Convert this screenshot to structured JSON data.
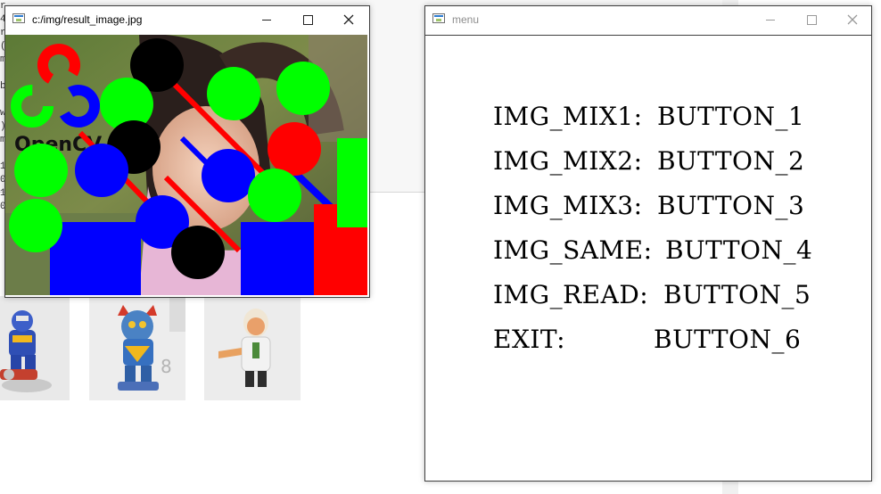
{
  "background_editor": {
    "gutter_lines": [
      "r",
      "4",
      "r",
      "(",
      "m",
      "",
      "b",
      "",
      "w",
      ")",
      "m",
      "",
      "1",
      "0",
      "1",
      "0"
    ]
  },
  "result_window": {
    "title": "c:/img/result_image.jpg",
    "logo_text": "OpenCV",
    "controls": {
      "minimize": "minimize-icon",
      "maximize": "maximize-icon",
      "close": "close-icon"
    }
  },
  "menu_window": {
    "title": "menu",
    "controls": {
      "minimize": "minimize-icon",
      "maximize": "maximize-icon",
      "close": "close-icon"
    },
    "lines": [
      {
        "key": "IMG_MIX1:",
        "value": "BUTTON_1"
      },
      {
        "key": "IMG_MIX2:",
        "value": "BUTTON_2"
      },
      {
        "key": "IMG_MIX3:",
        "value": "BUTTON_3"
      },
      {
        "key": "IMG_SAME:",
        "value": "BUTTON_4"
      },
      {
        "key": "IMG_READ:",
        "value": "BUTTON_5"
      },
      {
        "key": "EXIT:",
        "value": "BUTTON_6"
      }
    ]
  },
  "thumbnails": [
    "robot-toy-thumbnail",
    "cat-robot-toy-thumbnail",
    "scientist-figure-thumbnail"
  ],
  "colors": {
    "red": "#ff0000",
    "green": "#00ff00",
    "blue": "#0000ff",
    "black": "#000000"
  }
}
